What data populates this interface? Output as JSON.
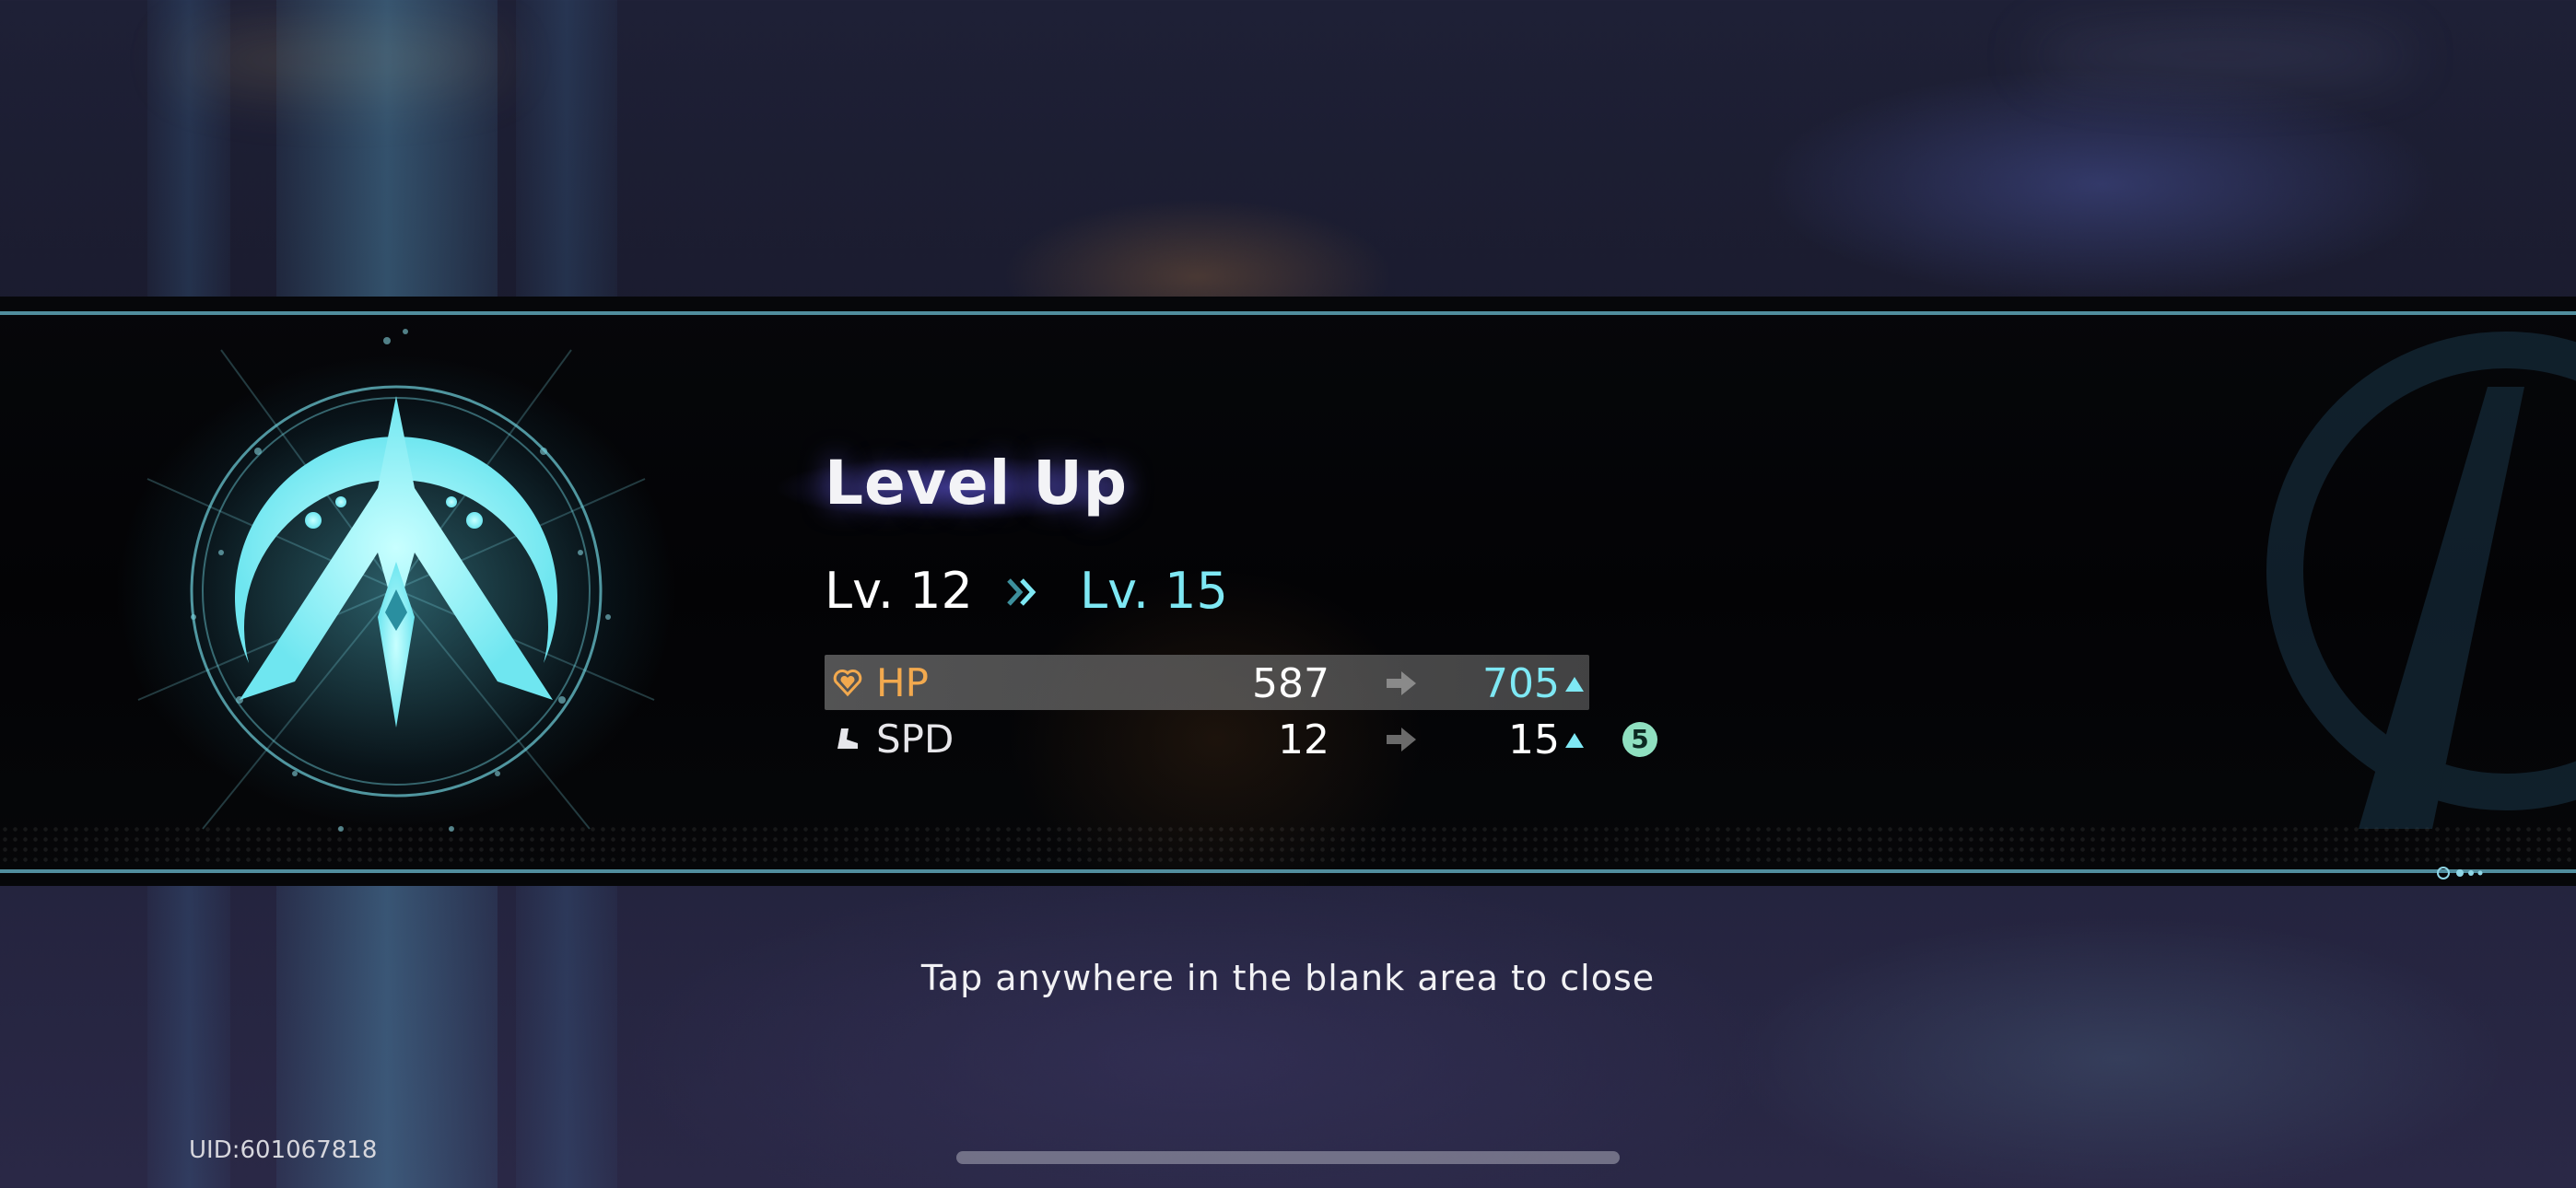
{
  "title": "Level Up",
  "level": {
    "from": "Lv. 12",
    "to": "Lv. 15"
  },
  "stats": [
    {
      "name": "HP",
      "old": "587",
      "new": "705",
      "icon": "heart-icon",
      "name_color": "#f2a94e",
      "new_color": "#7ee8f4"
    },
    {
      "name": "SPD",
      "old": "12",
      "new": "15",
      "icon": "boot-icon",
      "name_color": "#e6e6ea",
      "new_color": "#ffffff",
      "bonus": "5"
    }
  ],
  "close_hint": "Tap anywhere in the blank area to close",
  "uid": "UID:601067818",
  "colors": {
    "accent": "#7ee8f4",
    "line": "#5fa6b8",
    "bonus_badge": "#8fe0c0"
  },
  "emblem_icon": "path-emblem-icon"
}
